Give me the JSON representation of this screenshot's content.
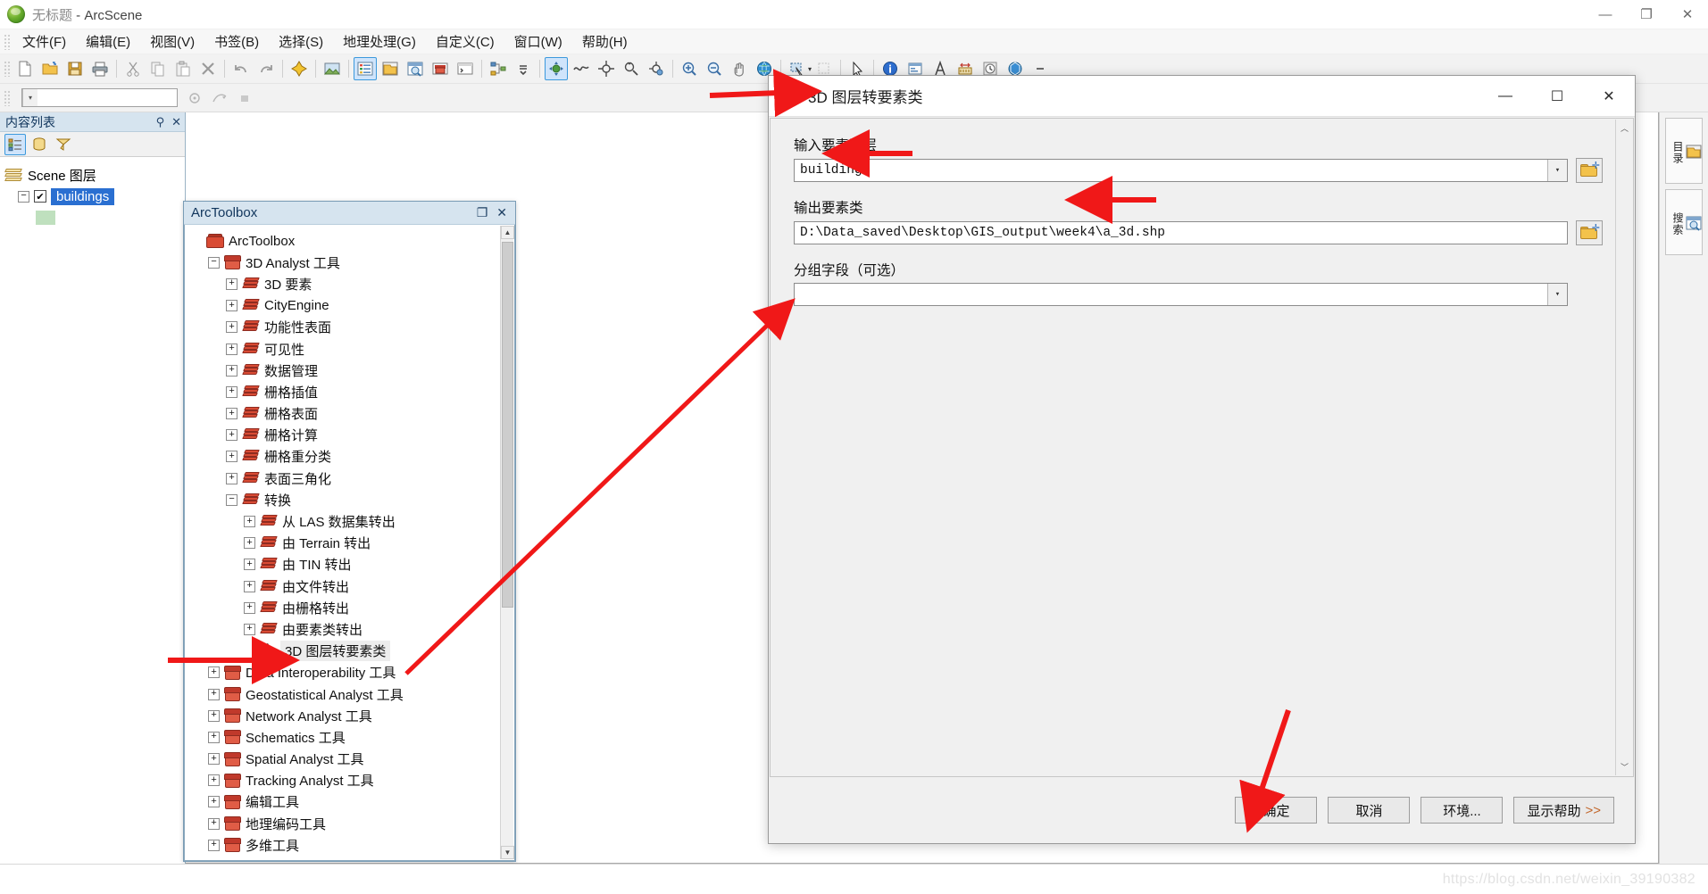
{
  "window": {
    "title_untitled": "无标题",
    "title_app": " - ArcScene",
    "minimize": "—",
    "maximize": "❐",
    "close": "✕"
  },
  "menubar": {
    "items": [
      {
        "label": "文件(F)"
      },
      {
        "label": "编辑(E)"
      },
      {
        "label": "视图(V)"
      },
      {
        "label": "书签(B)"
      },
      {
        "label": "选择(S)"
      },
      {
        "label": "地理处理(G)"
      },
      {
        "label": "自定义(C)"
      },
      {
        "label": "窗口(W)"
      },
      {
        "label": "帮助(H)"
      }
    ]
  },
  "toolbar2": {
    "combo_value": "",
    "combo_arrow": "▾"
  },
  "toc": {
    "title": "内容列表",
    "pin": "⚲",
    "close": "✕",
    "tools": [
      "list-by-drawing-order-icon",
      "list-by-source-icon",
      "list-by-visibility-icon"
    ],
    "scene_layer": "Scene 图层",
    "layer_name": "buildings",
    "layer_checked": "✔",
    "expander": "−"
  },
  "arctoolbox": {
    "window_title": "ArcToolbox",
    "restore": "❐",
    "close": "✕",
    "root": "ArcToolbox",
    "tree": [
      {
        "label": "ArcToolbox",
        "indent": 0,
        "icon": "toolbox-home",
        "exp": ""
      },
      {
        "label": "3D Analyst 工具",
        "indent": 1,
        "icon": "toolbox",
        "exp": "−"
      },
      {
        "label": "3D 要素",
        "indent": 2,
        "icon": "toolset",
        "exp": "+"
      },
      {
        "label": "CityEngine",
        "indent": 2,
        "icon": "toolset",
        "exp": "+"
      },
      {
        "label": "功能性表面",
        "indent": 2,
        "icon": "toolset",
        "exp": "+"
      },
      {
        "label": "可见性",
        "indent": 2,
        "icon": "toolset",
        "exp": "+"
      },
      {
        "label": "数据管理",
        "indent": 2,
        "icon": "toolset",
        "exp": "+"
      },
      {
        "label": "栅格插值",
        "indent": 2,
        "icon": "toolset",
        "exp": "+"
      },
      {
        "label": "栅格表面",
        "indent": 2,
        "icon": "toolset",
        "exp": "+"
      },
      {
        "label": "栅格计算",
        "indent": 2,
        "icon": "toolset",
        "exp": "+"
      },
      {
        "label": "栅格重分类",
        "indent": 2,
        "icon": "toolset",
        "exp": "+"
      },
      {
        "label": "表面三角化",
        "indent": 2,
        "icon": "toolset",
        "exp": "+"
      },
      {
        "label": "转换",
        "indent": 2,
        "icon": "toolset",
        "exp": "−"
      },
      {
        "label": "从 LAS 数据集转出",
        "indent": 3,
        "icon": "toolset",
        "exp": "+"
      },
      {
        "label": "由 Terrain 转出",
        "indent": 3,
        "icon": "toolset",
        "exp": "+"
      },
      {
        "label": "由 TIN 转出",
        "indent": 3,
        "icon": "toolset",
        "exp": "+"
      },
      {
        "label": "由文件转出",
        "indent": 3,
        "icon": "toolset",
        "exp": "+"
      },
      {
        "label": "由栅格转出",
        "indent": 3,
        "icon": "toolset",
        "exp": "+"
      },
      {
        "label": "由要素类转出",
        "indent": 3,
        "icon": "toolset",
        "exp": "+"
      },
      {
        "label": "3D 图层转要素类",
        "indent": 3,
        "icon": "hammer",
        "exp": "",
        "selected": true
      },
      {
        "label": "Data Interoperability 工具",
        "indent": 1,
        "icon": "toolbox",
        "exp": "+"
      },
      {
        "label": "Geostatistical Analyst 工具",
        "indent": 1,
        "icon": "toolbox",
        "exp": "+"
      },
      {
        "label": "Network Analyst 工具",
        "indent": 1,
        "icon": "toolbox",
        "exp": "+"
      },
      {
        "label": "Schematics 工具",
        "indent": 1,
        "icon": "toolbox",
        "exp": "+"
      },
      {
        "label": "Spatial Analyst 工具",
        "indent": 1,
        "icon": "toolbox",
        "exp": "+"
      },
      {
        "label": "Tracking Analyst 工具",
        "indent": 1,
        "icon": "toolbox",
        "exp": "+"
      },
      {
        "label": "编辑工具",
        "indent": 1,
        "icon": "toolbox",
        "exp": "+"
      },
      {
        "label": "地理编码工具",
        "indent": 1,
        "icon": "toolbox",
        "exp": "+"
      },
      {
        "label": "多维工具",
        "indent": 1,
        "icon": "toolbox",
        "exp": "+"
      }
    ],
    "scroll_up": "▲",
    "scroll_down": "▼"
  },
  "dialog": {
    "title": "3D 图层转要素类",
    "minimize": "—",
    "maximize": "☐",
    "close": "✕",
    "fields": [
      {
        "label": "输入要素图层",
        "value": "buildings",
        "type": "combo-with-browse",
        "dropdown_arrow": "▾"
      },
      {
        "label": "输出要素类",
        "value": "D:\\Data_saved\\Desktop\\GIS_output\\week4\\a_3d.shp",
        "type": "text-with-browse"
      },
      {
        "label": "分组字段（可选）",
        "value": "",
        "type": "combo",
        "dropdown_arrow": "▾"
      }
    ],
    "scroll_up": "︿",
    "scroll_down": "﹀",
    "buttons": [
      {
        "label": "确定",
        "name": "ok-button"
      },
      {
        "label": "取消",
        "name": "cancel-button"
      },
      {
        "label": "环境...",
        "name": "environments-button"
      },
      {
        "label": "显示帮助",
        "suffix": ">>",
        "name": "show-help-button"
      }
    ]
  },
  "statusbar": {
    "watermark": "https://blog.csdn.net/weixin_39190382"
  },
  "rightdock": {
    "items": [
      {
        "label": "目录",
        "icon": "catalog-icon"
      },
      {
        "label": "搜索",
        "icon": "search-icon"
      }
    ]
  },
  "colors": {
    "accent_blue": "#2a6fd1",
    "annotation_red": "#f01818",
    "building_green": "#b9d6b4",
    "panel_header": "#d6e4ef"
  }
}
